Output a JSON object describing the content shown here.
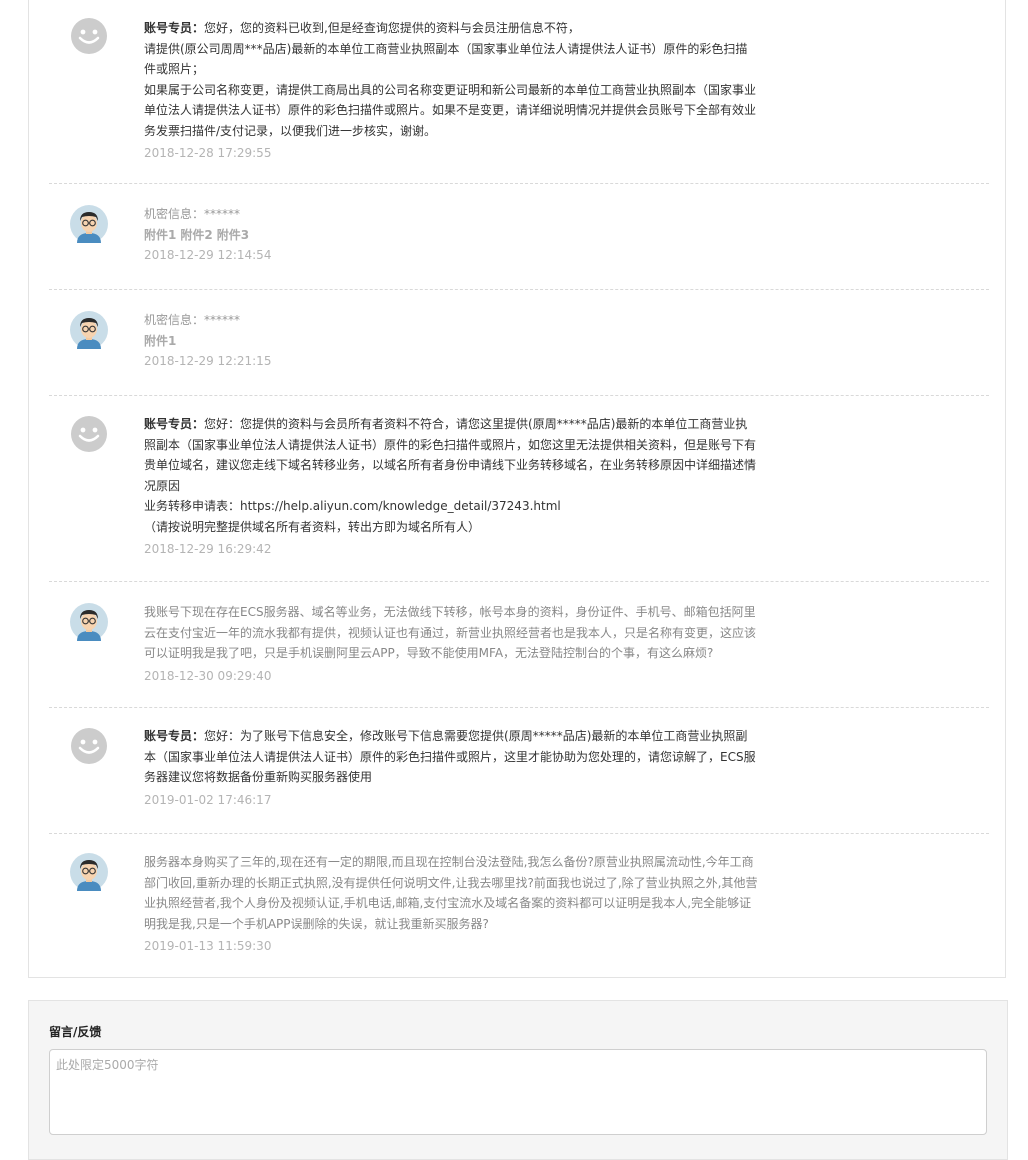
{
  "messages": [
    {
      "role": "staff",
      "label": "账号专员：",
      "lines": [
        "您好，您的资料已收到,但是经查询您提供的资料与会员注册信息不符，",
        "请提供(原公司周周***品店)最新的本单位工商营业执照副本（国家事业单位法人请提供法人证书）原件的彩色扫描件或照片；",
        "如果属于公司名称变更，请提供工商局出具的公司名称变更证明和新公司最新的本单位工商营业执照副本（国家事业单位法人请提供法人证书）原件的彩色扫描件或照片。如果不是变更，请详细说明情况并提供会员账号下全部有效业务发票扫描件/支付记录，以便我们进一步核实，谢谢。"
      ],
      "time": "2018-12-28 17:29:55"
    },
    {
      "role": "user",
      "secret": "机密信息：******",
      "attachments": [
        "附件1",
        "附件2",
        "附件3"
      ],
      "time": "2018-12-29 12:14:54"
    },
    {
      "role": "user",
      "secret": "机密信息：******",
      "attachments": [
        "附件1"
      ],
      "time": "2018-12-29 12:21:15"
    },
    {
      "role": "staff",
      "label": "账号专员：",
      "lines": [
        "您好：您提供的资料与会员所有者资料不符合，请您这里提供(原周*****品店)最新的本单位工商营业执照副本（国家事业单位法人请提供法人证书）原件的彩色扫描件或照片，如您这里无法提供相关资料，但是账号下有贵单位域名，建议您走线下域名转移业务，以域名所有者身份申请线下业务转移域名，在业务转移原因中详细描述情况原因",
        "业务转移申请表：https://help.aliyun.com/knowledge_detail/37243.html",
        "（请按说明完整提供域名所有者资料，转出方即为域名所有人）"
      ],
      "time": "2018-12-29 16:29:42"
    },
    {
      "role": "user",
      "lines": [
        "我账号下现在存在ECS服务器、域名等业务，无法做线下转移，帐号本身的资料，身份证件、手机号、邮箱包括阿里云在支付宝近一年的流水我都有提供，视频认证也有通过，新营业执照经营者也是我本人，只是名称有变更，这应该可以证明我是我了吧，只是手机误删阿里云APP，导致不能使用MFA，无法登陆控制台的个事，有这么麻烦?"
      ],
      "time": "2018-12-30 09:29:40"
    },
    {
      "role": "staff",
      "label": "账号专员：",
      "lines": [
        "您好：为了账号下信息安全，修改账号下信息需要您提供(原周*****品店)最新的本单位工商营业执照副本（国家事业单位法人请提供法人证书）原件的彩色扫描件或照片，这里才能协助为您处理的，请您谅解了，ECS服务器建议您将数据备份重新购买服务器使用"
      ],
      "time": "2019-01-02 17:46:17"
    },
    {
      "role": "user",
      "lines": [
        "服务器本身购买了三年的,现在还有一定的期限,而且现在控制台没法登陆,我怎么备份?原营业执照属流动性,今年工商部门收回,重新办理的长期正式执照,没有提供任何说明文件,让我去哪里找?前面我也说过了,除了营业执照之外,其他营业执照经营者,我个人身份及视频认证,手机电话,邮箱,支付宝流水及域名备案的资料都可以证明是我本人,完全能够证明我是我,只是一个手机APP误删除的失误，就让我重新买服务器?"
      ],
      "time": "2019-01-13 11:59:30"
    }
  ],
  "feedback": {
    "title": "留言/反馈",
    "placeholder": "此处限定5000字符"
  }
}
